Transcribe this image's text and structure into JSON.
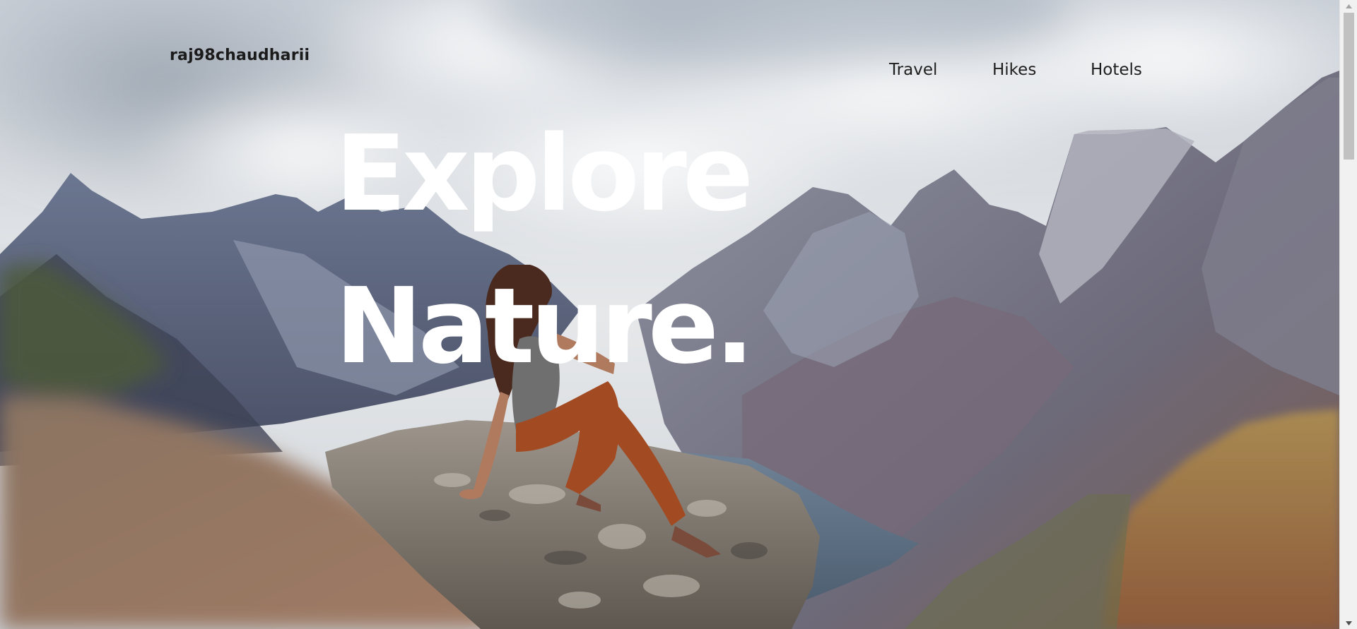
{
  "header": {
    "brand": "raj98chaudharii",
    "nav": [
      {
        "label": "Travel"
      },
      {
        "label": "Hikes"
      },
      {
        "label": "Hotels"
      }
    ]
  },
  "hero": {
    "line1": "Explore",
    "line2": "Nature.",
    "background": "photo of a woman sitting on a rock overlooking mountains and a fjord"
  },
  "colors": {
    "headline": "#ffffff",
    "nav_text": "#1f1f1f",
    "scrollbar_track": "#f1f1f1",
    "scrollbar_thumb": "#c1c1c1"
  },
  "icons": {
    "scroll_up": "triangle-up",
    "scroll_down": "triangle-down"
  }
}
